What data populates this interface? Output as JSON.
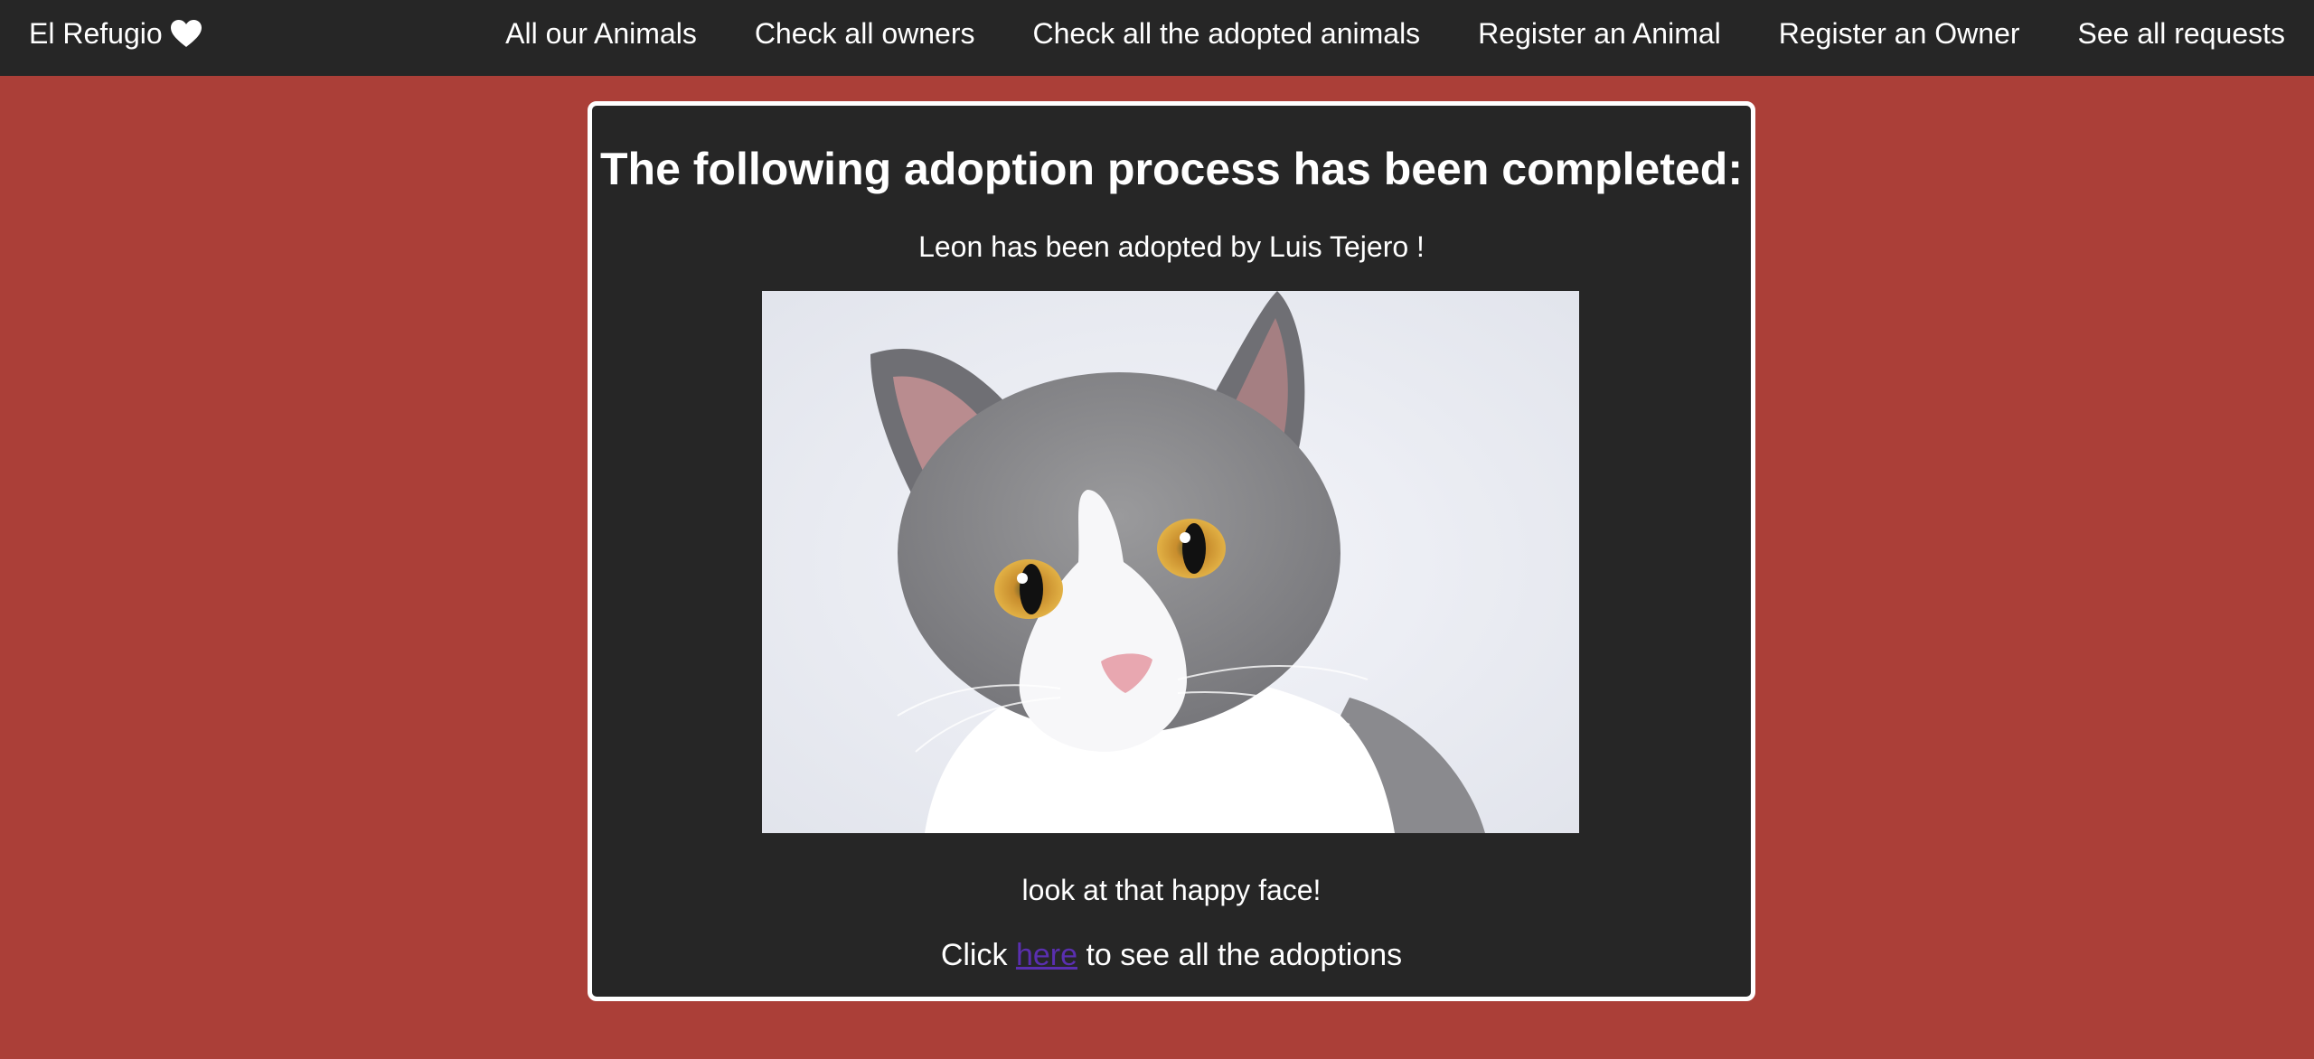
{
  "navbar": {
    "brand": "El Refugio",
    "brand_icon": "heart-icon",
    "links": [
      "All our Animals",
      "Check all owners",
      "Check all the adopted animals",
      "Register an Animal",
      "Register an Owner",
      "See all requests"
    ]
  },
  "card": {
    "title": "The following adoption process has been completed:",
    "animal_name": "Leon",
    "adopted_by_text": "has been adopted by",
    "owner_name": "Luis Tejero",
    "exclamation": "!",
    "photo_alt": "cat photo",
    "caption": "look at that happy face!",
    "link_prefix": "Click",
    "link_label": "here",
    "link_suffix": "to see all the adoptions"
  },
  "colors": {
    "page_background": "#ab3f38",
    "navbar_background": "#262626",
    "card_background": "#262626",
    "link": "#5a2fb0"
  }
}
